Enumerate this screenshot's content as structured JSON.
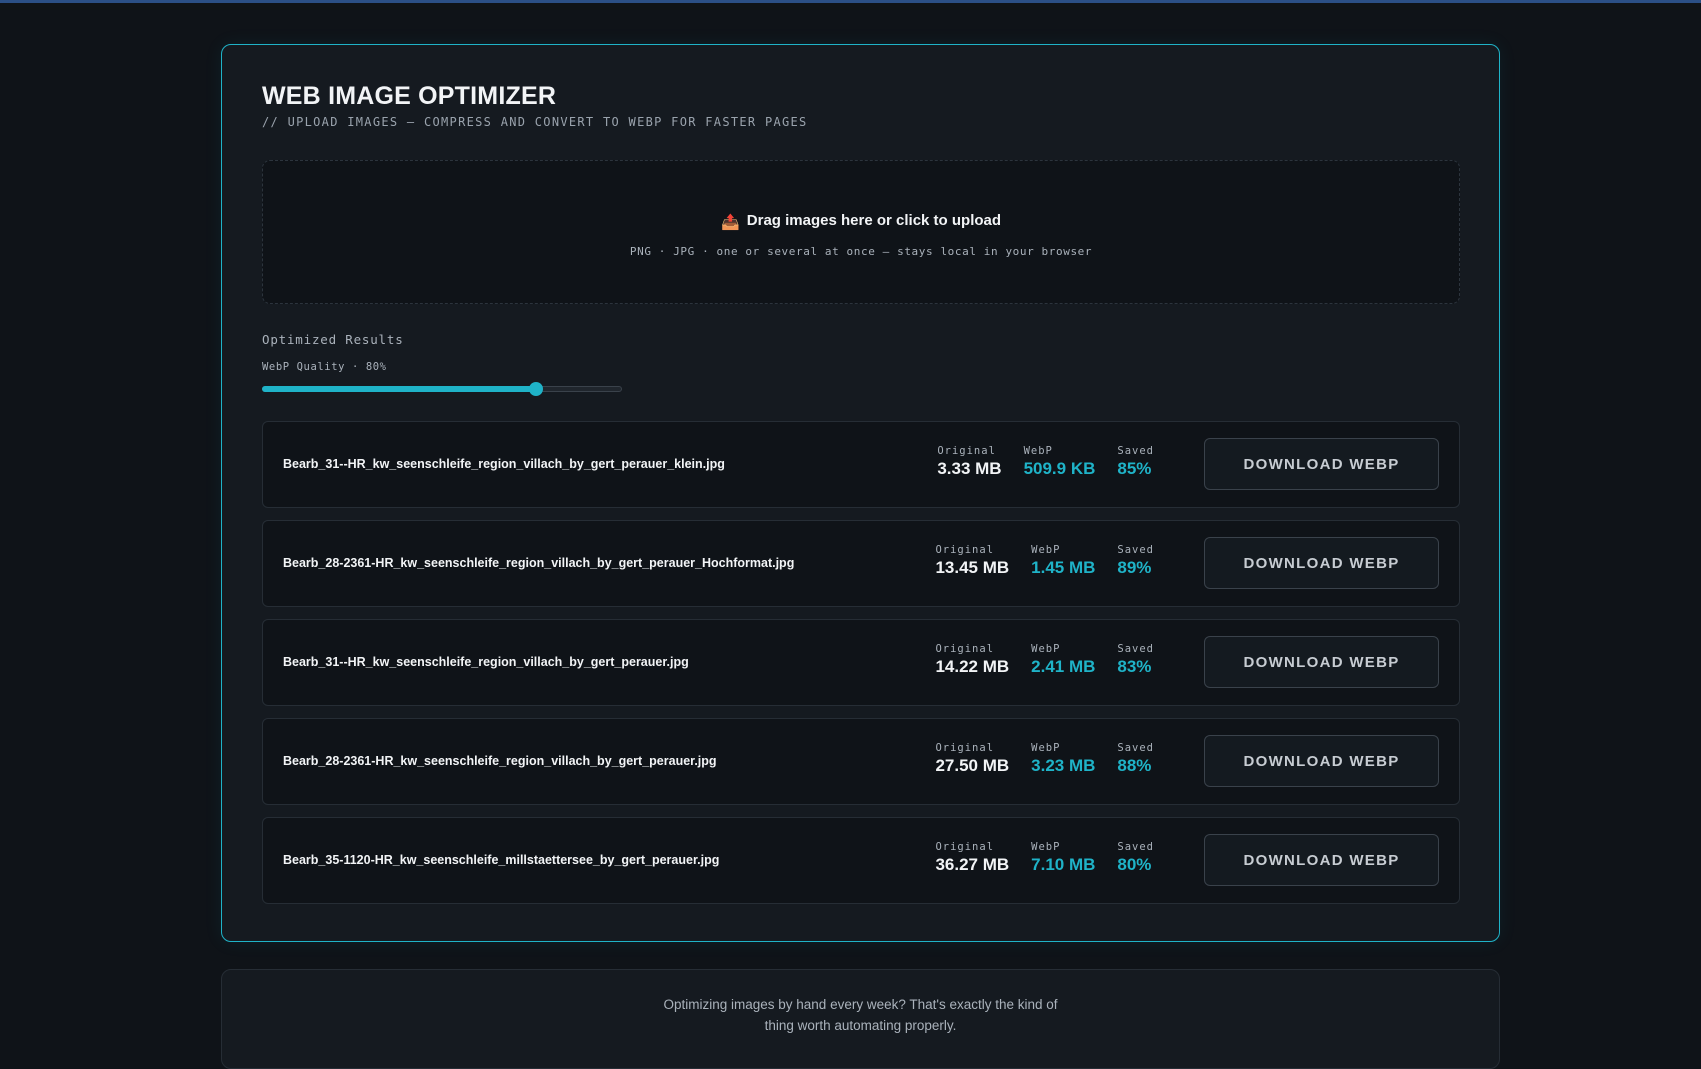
{
  "header": {
    "title": "WEB IMAGE OPTIMIZER",
    "subtitle": "// UPLOAD IMAGES — COMPRESS AND CONVERT TO WEBP FOR FASTER PAGES"
  },
  "dropzone": {
    "icon": "📤",
    "icon_name": "upload-tray-icon",
    "title": "Drag images here or click to upload",
    "hint": "PNG · JPG · one or several at once — stays local in your browser"
  },
  "results": {
    "section_label": "Optimized Results",
    "quality_label": "WebP Quality · 80%",
    "quality_value": 80,
    "labels": {
      "original": "Original",
      "webp": "WebP",
      "saved": "Saved"
    },
    "download_label": "DOWNLOAD WEBP",
    "items": [
      {
        "name": "Bearb_31--HR_kw_seenschleife_region_villach_by_gert_perauer_klein.jpg",
        "original": "3.33 MB",
        "webp": "509.9 KB",
        "saved": "85%"
      },
      {
        "name": "Bearb_28-2361-HR_kw_seenschleife_region_villach_by_gert_perauer_Hochformat.jpg",
        "original": "13.45 MB",
        "webp": "1.45 MB",
        "saved": "89%"
      },
      {
        "name": "Bearb_31--HR_kw_seenschleife_region_villach_by_gert_perauer.jpg",
        "original": "14.22 MB",
        "webp": "2.41 MB",
        "saved": "83%"
      },
      {
        "name": "Bearb_28-2361-HR_kw_seenschleife_region_villach_by_gert_perauer.jpg",
        "original": "27.50 MB",
        "webp": "3.23 MB",
        "saved": "88%"
      },
      {
        "name": "Bearb_35-1120-HR_kw_seenschleife_millstaettersee_by_gert_perauer.jpg",
        "original": "36.27 MB",
        "webp": "7.10 MB",
        "saved": "80%"
      }
    ]
  },
  "promo": {
    "text": "Optimizing images by hand every week? That's exactly the kind of thing worth automating properly."
  },
  "colors": {
    "accent": "#1fb3c8",
    "background": "#0f1318",
    "card": "#151a20"
  }
}
